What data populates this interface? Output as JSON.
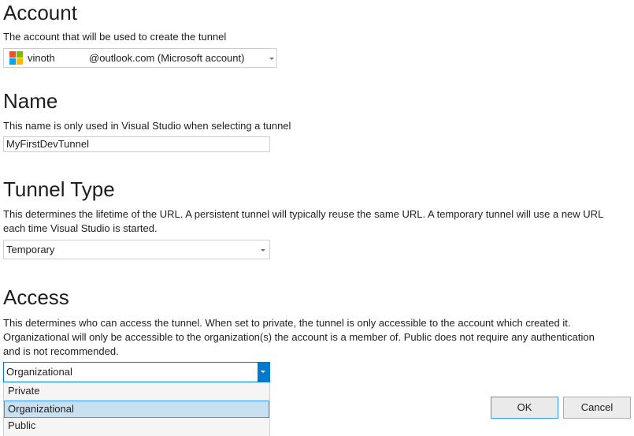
{
  "account": {
    "heading": "Account",
    "description": "The account that will be used to create the tunnel",
    "value": "vinoth            @outlook.com (Microsoft account)",
    "logo_colors": [
      "#f25022",
      "#7fba00",
      "#00a4ef",
      "#ffb900"
    ]
  },
  "name": {
    "heading": "Name",
    "description": "This name is only used in Visual Studio when selecting a tunnel",
    "value": "MyFirstDevTunnel"
  },
  "tunnel_type": {
    "heading": "Tunnel Type",
    "description_line1": "This determines the lifetime of the URL. A persistent tunnel will typically reuse the same URL. A temporary tunnel will use a new URL",
    "description_line2": "each time Visual Studio is started.",
    "selected": "Temporary"
  },
  "access": {
    "heading": "Access",
    "description_line1": "This determines who can access the tunnel. When set to private, the tunnel is only accessible to the account which created it.",
    "description_line2": "Organizational will only be accessible to the organization(s) the account is a member of. Public does not require any authentication",
    "description_line3": "and is not recommended.",
    "selected": "Organizational",
    "options": [
      "Private",
      "Organizational",
      "Public"
    ]
  },
  "buttons": {
    "ok": "OK",
    "cancel": "Cancel"
  },
  "colors": {
    "accent": "#007acc",
    "selection_bg": "#c9e0f0",
    "selection_border": "#3399ff"
  }
}
